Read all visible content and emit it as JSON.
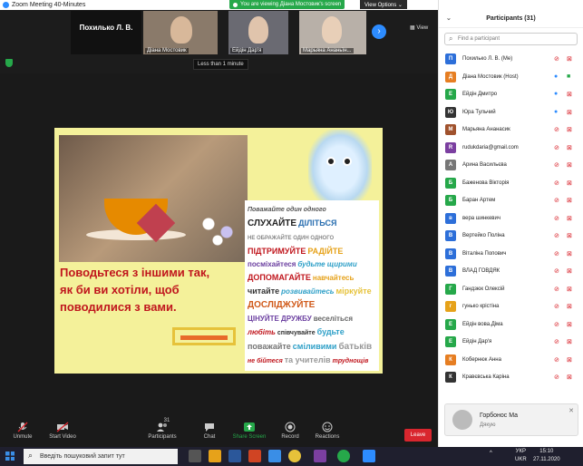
{
  "window": {
    "title": "Zoom Meeting 40-Minutes",
    "share_banner": "You are viewing Діана Мостовик's screen",
    "view_options": "View Options ⌄",
    "minimize": "–",
    "maximize": "□",
    "close": "✕"
  },
  "strip": {
    "tiles": [
      {
        "name": "Похилько Л. В.",
        "big": true
      },
      {
        "name": "Діана Мостовик"
      },
      {
        "name": "Ейдін Дар'я"
      },
      {
        "name": "Марьяна Ананьїн..."
      }
    ],
    "tooltip": "Less than 1 minute",
    "view_label": "▦ View",
    "next_icon": "›"
  },
  "slide": {
    "quote_lines": [
      "Поводьтеся з іншими так,",
      "як би ви хотіли, щоб",
      "поводилися з вами."
    ],
    "word_cloud": [
      {
        "t": "Поважайте один одного",
        "c": "#555",
        "s": 7,
        "i": true
      },
      {
        "t": "СЛУХАЙТЕ",
        "c": "#222",
        "s": 10
      },
      {
        "t": "ДІЛІТЬСЯ",
        "c": "#2a6fb0",
        "s": 9
      },
      {
        "t": "НЕ ОБРАЖАЙТЕ ОДИН ОДНОГО",
        "c": "#888",
        "s": 6
      },
      {
        "t": "ПІДТРИМУЙТЕ",
        "c": "#c0161d",
        "s": 9
      },
      {
        "t": "РАДІЙТЕ",
        "c": "#e6a21a",
        "s": 9
      },
      {
        "t": "посміхайтеся",
        "c": "#6b3fa0",
        "s": 8
      },
      {
        "t": "будьте щирими",
        "c": "#2fa0c8",
        "s": 8,
        "i": true
      },
      {
        "t": "ДОПОМАГАЙТЕ",
        "c": "#c0161d",
        "s": 9
      },
      {
        "t": "навчайтесь",
        "c": "#e6a21a",
        "s": 8
      },
      {
        "t": "читайте",
        "c": "#333",
        "s": 9
      },
      {
        "t": "розвивайтесь",
        "c": "#2fa0c8",
        "s": 8,
        "i": true
      },
      {
        "t": "міркуйте",
        "c": "#e6c23a",
        "s": 9
      },
      {
        "t": "ДОСЛІДЖУЙТЕ",
        "c": "#d05a1a",
        "s": 10
      },
      {
        "t": "ЦІНУЙТЕ ДРУЖБУ",
        "c": "#6b3fa0",
        "s": 8
      },
      {
        "t": "веселіться",
        "c": "#666",
        "s": 8
      },
      {
        "t": "любіть",
        "c": "#c0161d",
        "s": 8,
        "i": true
      },
      {
        "t": "співчувайте",
        "c": "#333",
        "s": 7
      },
      {
        "t": "будьте",
        "c": "#2fa0c8",
        "s": 9
      },
      {
        "t": "поважайте",
        "c": "#777",
        "s": 9
      },
      {
        "t": "сміливими",
        "c": "#2fa0c8",
        "s": 9
      },
      {
        "t": "батьків",
        "c": "#999",
        "s": 10
      },
      {
        "t": "не бійтеся",
        "c": "#c0161d",
        "s": 7,
        "i": true
      },
      {
        "t": "та учителів",
        "c": "#999",
        "s": 9
      },
      {
        "t": "труднощів",
        "c": "#c0161d",
        "s": 7,
        "i": true
      }
    ]
  },
  "toolbar": {
    "unmute": "Unmute",
    "start_video": "Start Video",
    "participants": "Participants",
    "participants_count": "31",
    "chat": "Chat",
    "share_screen": "Share Screen",
    "record": "Record",
    "reactions": "Reactions",
    "leave": "Leave"
  },
  "panel": {
    "title": "Participants (31)",
    "search_placeholder": "Find a participant",
    "participants": [
      {
        "initial": "П",
        "color": "#2d6fd9",
        "name": "Похилько Л. В. (Me)",
        "mic": "off",
        "cam": "off"
      },
      {
        "initial": "Д",
        "color": "#e67e22",
        "name": "Діана Мостовик (Host)",
        "mic": "on",
        "cam": "green"
      },
      {
        "initial": "Е",
        "color": "#26a84a",
        "name": "Ейдін Дмитро",
        "mic": "on",
        "cam": "off"
      },
      {
        "initial": "Ю",
        "color": "#333",
        "name": "Юра Тульчий",
        "mic": "on",
        "cam": "off"
      },
      {
        "initial": "М",
        "color": "#a0522d",
        "name": "Марьяна Ананасик",
        "mic": "off",
        "cam": "off"
      },
      {
        "initial": "R",
        "color": "#7b3fa0",
        "name": "rudukdaria@gmail.com",
        "mic": "off",
        "cam": "off"
      },
      {
        "initial": "А",
        "color": "#777",
        "name": "Арина Васильєва",
        "mic": "off",
        "cam": "off"
      },
      {
        "initial": "Б",
        "color": "#26a84a",
        "name": "Баженова Вікторія",
        "mic": "off",
        "cam": "off"
      },
      {
        "initial": "Б",
        "color": "#26a84a",
        "name": "Баран Артем",
        "mic": "off",
        "cam": "off"
      },
      {
        "initial": "в",
        "color": "#2d6fd9",
        "name": "вера шинкевич",
        "mic": "off",
        "cam": "off"
      },
      {
        "initial": "В",
        "color": "#2d6fd9",
        "name": "Вертейко Поліна",
        "mic": "off",
        "cam": "off"
      },
      {
        "initial": "В",
        "color": "#2d6fd9",
        "name": "Віталіна Попович",
        "mic": "off",
        "cam": "off"
      },
      {
        "initial": "В",
        "color": "#2d6fd9",
        "name": "ВЛАД ГОВДЯК",
        "mic": "off",
        "cam": "off"
      },
      {
        "initial": "Г",
        "color": "#26a84a",
        "name": "Гандзюк Олексій",
        "mic": "off",
        "cam": "off"
      },
      {
        "initial": "г",
        "color": "#e6a21a",
        "name": "гунько крістіна",
        "mic": "off",
        "cam": "off"
      },
      {
        "initial": "Е",
        "color": "#26a84a",
        "name": "Ейдін вова.Діма",
        "mic": "off",
        "cam": "off"
      },
      {
        "initial": "Е",
        "color": "#26a84a",
        "name": "Ейдін Дар'я",
        "mic": "off",
        "cam": "off"
      },
      {
        "initial": "К",
        "color": "#e67e22",
        "name": "Кобернюк Анна",
        "mic": "off",
        "cam": "off"
      },
      {
        "initial": "К",
        "color": "#333",
        "name": "Кравєвська Каріна",
        "mic": "off",
        "cam": "off"
      }
    ],
    "toast": {
      "name": "Горбонос Ма",
      "message": "Дякую",
      "close": "✕"
    }
  },
  "taskbar": {
    "search_placeholder": "Введіть пошуковий запит тут",
    "lang_top": "УКР",
    "lang_bottom": "UKR",
    "time": "15:10",
    "date": "27.11.2020",
    "tray_arrow": "^"
  }
}
